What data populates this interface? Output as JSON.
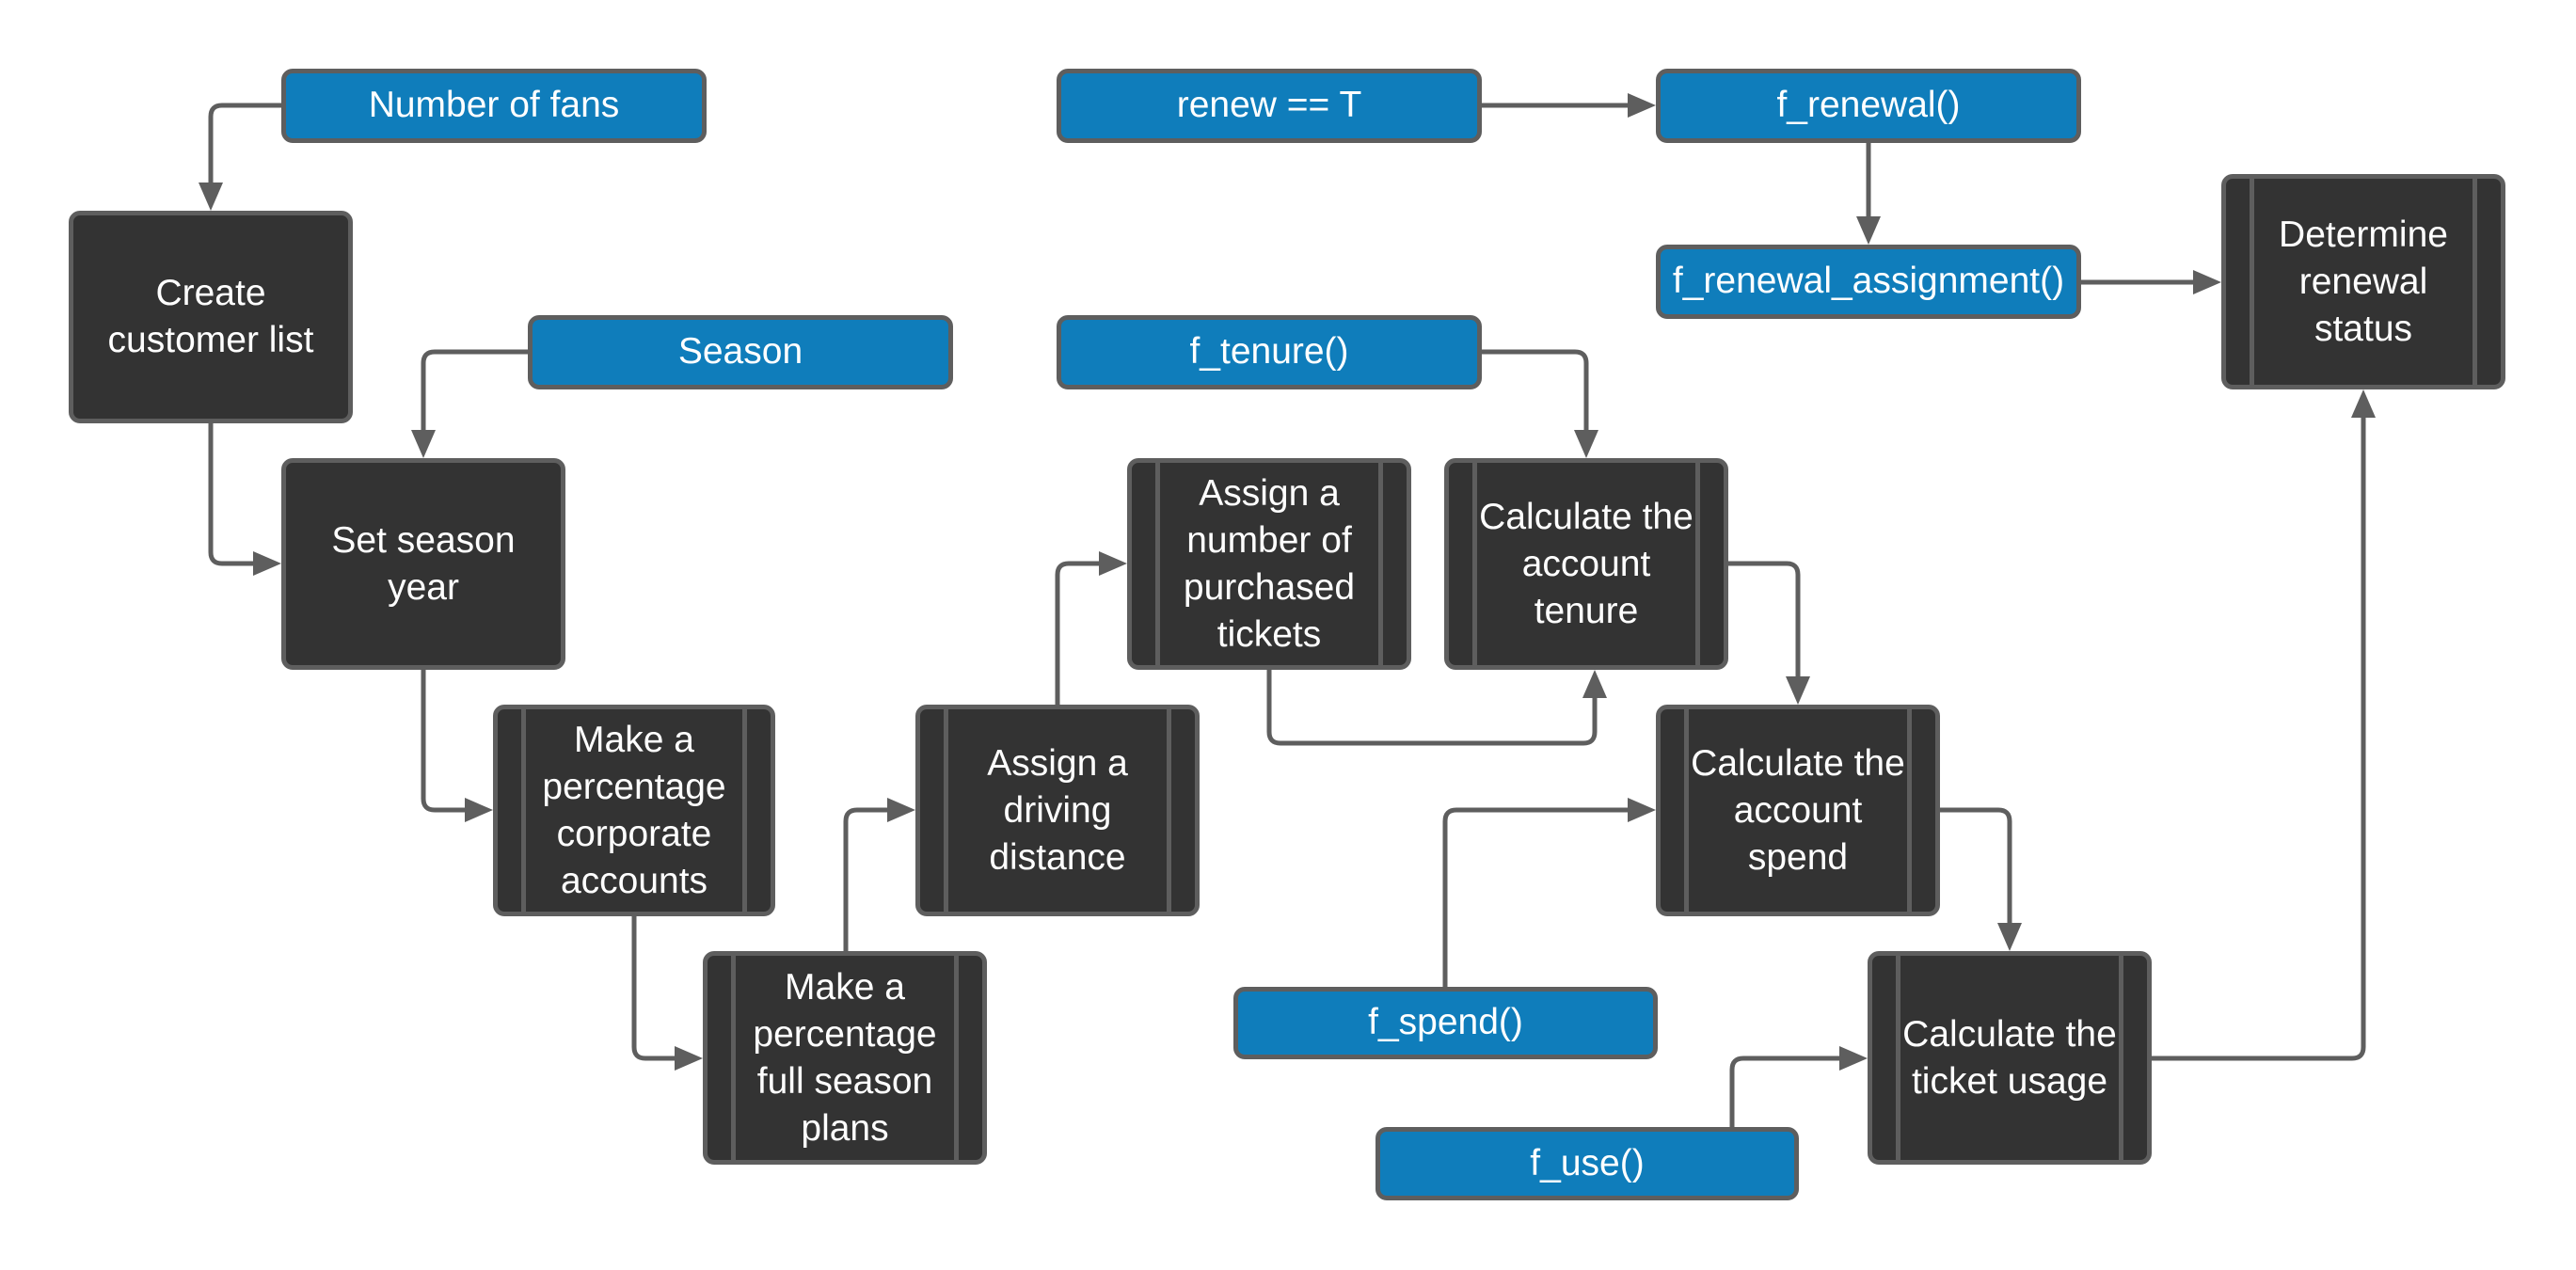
{
  "diagram": {
    "type": "flowchart",
    "colors": {
      "data_node": "#0f7dbb",
      "process_node": "#333333",
      "border": "#5e5e5e",
      "edge": "#5e5e5e",
      "text": "#ffffff"
    },
    "nodes": [
      {
        "id": "number_of_fans",
        "kind": "data",
        "label": "Number of fans"
      },
      {
        "id": "create_customer_list",
        "kind": "process",
        "label": "Create customer list"
      },
      {
        "id": "season",
        "kind": "data",
        "label": "Season"
      },
      {
        "id": "set_season_year",
        "kind": "process",
        "label": "Set season year"
      },
      {
        "id": "pct_corporate",
        "kind": "subprocess",
        "label": "Make a percentage corporate accounts"
      },
      {
        "id": "pct_full_season",
        "kind": "subprocess",
        "label": "Make a percentage full season plans"
      },
      {
        "id": "driving_distance",
        "kind": "subprocess",
        "label": "Assign a driving distance"
      },
      {
        "id": "purchased_tickets",
        "kind": "subprocess",
        "label": "Assign a number of purchased tickets"
      },
      {
        "id": "f_tenure",
        "kind": "data",
        "label": "f_tenure()"
      },
      {
        "id": "account_tenure",
        "kind": "subprocess",
        "label": "Calculate the account tenure"
      },
      {
        "id": "renew_eq_t",
        "kind": "data",
        "label": "renew == T"
      },
      {
        "id": "f_renewal",
        "kind": "data",
        "label": "f_renewal()"
      },
      {
        "id": "f_renewal_assignment",
        "kind": "data",
        "label": "f_renewal_assignment()"
      },
      {
        "id": "determine_renewal",
        "kind": "subprocess",
        "label": "Determine renewal status"
      },
      {
        "id": "account_spend",
        "kind": "subprocess",
        "label": "Calculate the account spend"
      },
      {
        "id": "f_spend",
        "kind": "data",
        "label": "f_spend()"
      },
      {
        "id": "ticket_usage",
        "kind": "subprocess",
        "label": "Calculate the ticket usage"
      },
      {
        "id": "f_use",
        "kind": "data",
        "label": "f_use()"
      }
    ],
    "edges": [
      {
        "from": "number_of_fans",
        "to": "create_customer_list"
      },
      {
        "from": "create_customer_list",
        "to": "set_season_year"
      },
      {
        "from": "season",
        "to": "set_season_year"
      },
      {
        "from": "set_season_year",
        "to": "pct_corporate"
      },
      {
        "from": "pct_corporate",
        "to": "pct_full_season"
      },
      {
        "from": "pct_full_season",
        "to": "driving_distance"
      },
      {
        "from": "driving_distance",
        "to": "purchased_tickets"
      },
      {
        "from": "purchased_tickets",
        "to": "account_tenure"
      },
      {
        "from": "f_tenure",
        "to": "account_tenure"
      },
      {
        "from": "account_tenure",
        "to": "account_spend"
      },
      {
        "from": "f_spend",
        "to": "account_spend"
      },
      {
        "from": "account_spend",
        "to": "ticket_usage"
      },
      {
        "from": "f_use",
        "to": "ticket_usage"
      },
      {
        "from": "ticket_usage",
        "to": "determine_renewal"
      },
      {
        "from": "renew_eq_t",
        "to": "f_renewal"
      },
      {
        "from": "f_renewal",
        "to": "f_renewal_assignment"
      },
      {
        "from": "f_renewal_assignment",
        "to": "determine_renewal"
      }
    ]
  }
}
